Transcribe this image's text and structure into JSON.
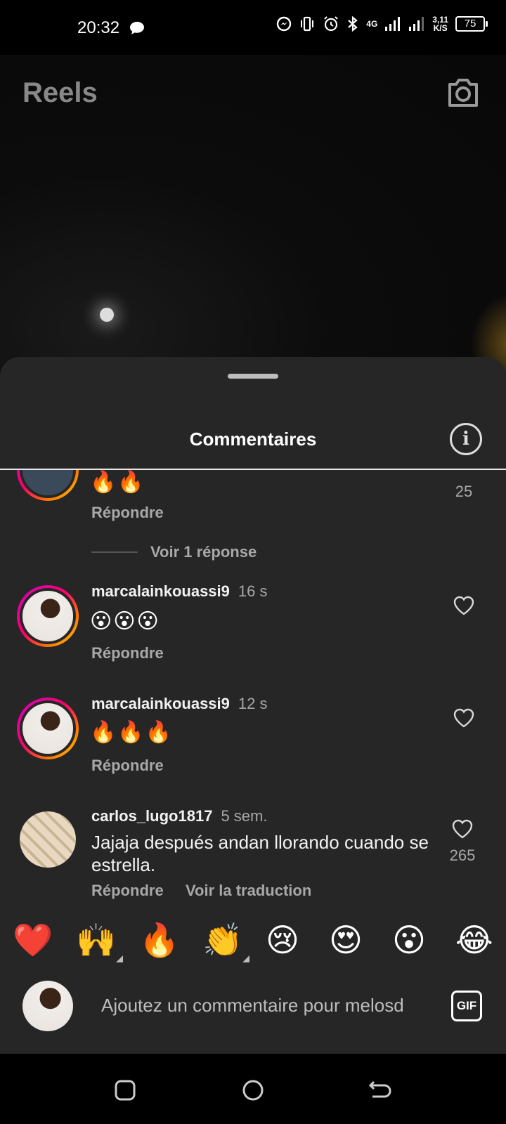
{
  "status": {
    "time": "20:32",
    "network": "4G",
    "speed_value": "3,11",
    "speed_unit": "K/S",
    "battery": "75"
  },
  "header": {
    "title": "Reels"
  },
  "sheet": {
    "title": "Commentaires"
  },
  "comments": [
    {
      "username": "",
      "time": "",
      "text": "🔥🔥",
      "likes": "25",
      "reply": "Répondre",
      "view_replies": "Voir 1 réponse"
    },
    {
      "username": "marcalainkouassi9",
      "time": "16 s",
      "text": "😮😮😮",
      "reply": "Répondre"
    },
    {
      "username": "marcalainkouassi9",
      "time": "12 s",
      "text": "🔥🔥🔥",
      "reply": "Répondre"
    },
    {
      "username": "carlos_lugo1817",
      "time": "5 sem.",
      "text": "Jajaja después andan llorando cuando se estrella.",
      "likes": "265",
      "reply": "Répondre",
      "translate": "Voir la traduction"
    }
  ],
  "reactions": [
    "❤️",
    "🙌",
    "🔥",
    "👏",
    "😢",
    "😍",
    "😮",
    "😂"
  ],
  "input": {
    "placeholder": "Ajoutez un commentaire pour melosd",
    "gif_label": "GIF"
  },
  "icons": {
    "info": "info-icon",
    "camera": "camera-icon",
    "heart": "heart-icon",
    "nav_recents": "square-icon",
    "nav_home": "circle-icon",
    "nav_back": "back-icon"
  }
}
